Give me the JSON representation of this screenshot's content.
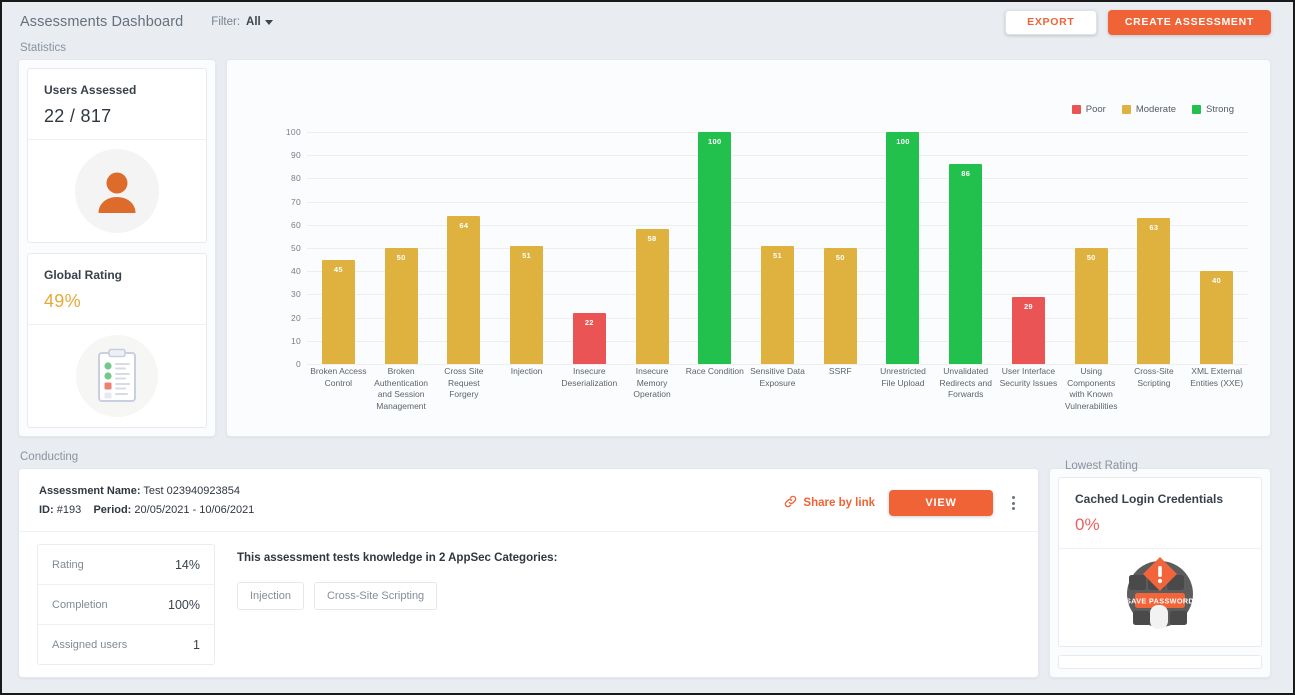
{
  "header": {
    "title": "Assessments Dashboard",
    "filter_label": "Filter:",
    "filter_value": "All",
    "export_label": "EXPORT",
    "create_label": "CREATE ASSESSMENT"
  },
  "sections": {
    "statistics_caption": "Statistics",
    "conducting_caption": "Conducting",
    "lowest_caption": "Lowest Rating"
  },
  "stats": {
    "users_assessed": {
      "title": "Users Assessed",
      "value": "22 / 817",
      "icon": "user-avatar-icon"
    },
    "global_rating": {
      "title": "Global Rating",
      "value": "49%",
      "color": "#e5a93a",
      "icon": "clipboard-checklist-icon"
    }
  },
  "chart_data": {
    "type": "bar",
    "title": "",
    "xlabel": "",
    "ylabel": "",
    "ylim": [
      0,
      100
    ],
    "yticks": [
      0,
      10,
      20,
      30,
      40,
      50,
      60,
      70,
      80,
      90,
      100
    ],
    "grid": true,
    "legend_position": "top-right",
    "legend": [
      {
        "name": "Poor",
        "color": "#ea5455"
      },
      {
        "name": "Moderate",
        "color": "#dfb23f"
      },
      {
        "name": "Strong",
        "color": "#22c14e"
      }
    ],
    "categories": [
      "Broken Access Control",
      "Broken Authentication and Session Management",
      "Cross Site Request Forgery",
      "Injection",
      "Insecure Deserialization",
      "Insecure Memory Operation",
      "Race Condition",
      "Sensitive Data Exposure",
      "SSRF",
      "Unrestricted File Upload",
      "Unvalidated Redirects and Forwards",
      "User Interface Security Issues",
      "Using Components with Known Vulnerabilities",
      "Cross-Site Scripting",
      "XML External Entities (XXE)"
    ],
    "values": [
      45,
      50,
      64,
      51,
      22,
      58,
      100,
      51,
      50,
      100,
      86,
      29,
      50,
      63,
      40
    ],
    "value_ratings": [
      "Moderate",
      "Moderate",
      "Moderate",
      "Moderate",
      "Poor",
      "Moderate",
      "Strong",
      "Moderate",
      "Moderate",
      "Strong",
      "Strong",
      "Poor",
      "Moderate",
      "Moderate",
      "Moderate"
    ]
  },
  "conducting": {
    "assessment_name_label": "Assessment Name:",
    "assessment_name": "Test 023940923854",
    "id_label": "ID:",
    "id_value": "#193",
    "period_label": "Period:",
    "period_value": "20/05/2021 - 10/06/2021",
    "share_label": "Share by link",
    "share_icon": "link-icon",
    "view_label": "VIEW",
    "more_icon": "kebab-menu-icon",
    "metrics": [
      {
        "label": "Rating",
        "value": "14%"
      },
      {
        "label": "Completion",
        "value": "100%"
      },
      {
        "label": "Assigned users",
        "value": "1"
      }
    ],
    "categories_title": "This assessment tests knowledge in 2 AppSec Categories:",
    "chips": [
      "Injection",
      "Cross-Site Scripting"
    ]
  },
  "lowest_rating": {
    "title": "Cached Login Credentials",
    "value": "0%",
    "color": "#ee5f5f",
    "icon": "save-password-key-icon",
    "icon_text": "SAVE PASSWORD"
  }
}
